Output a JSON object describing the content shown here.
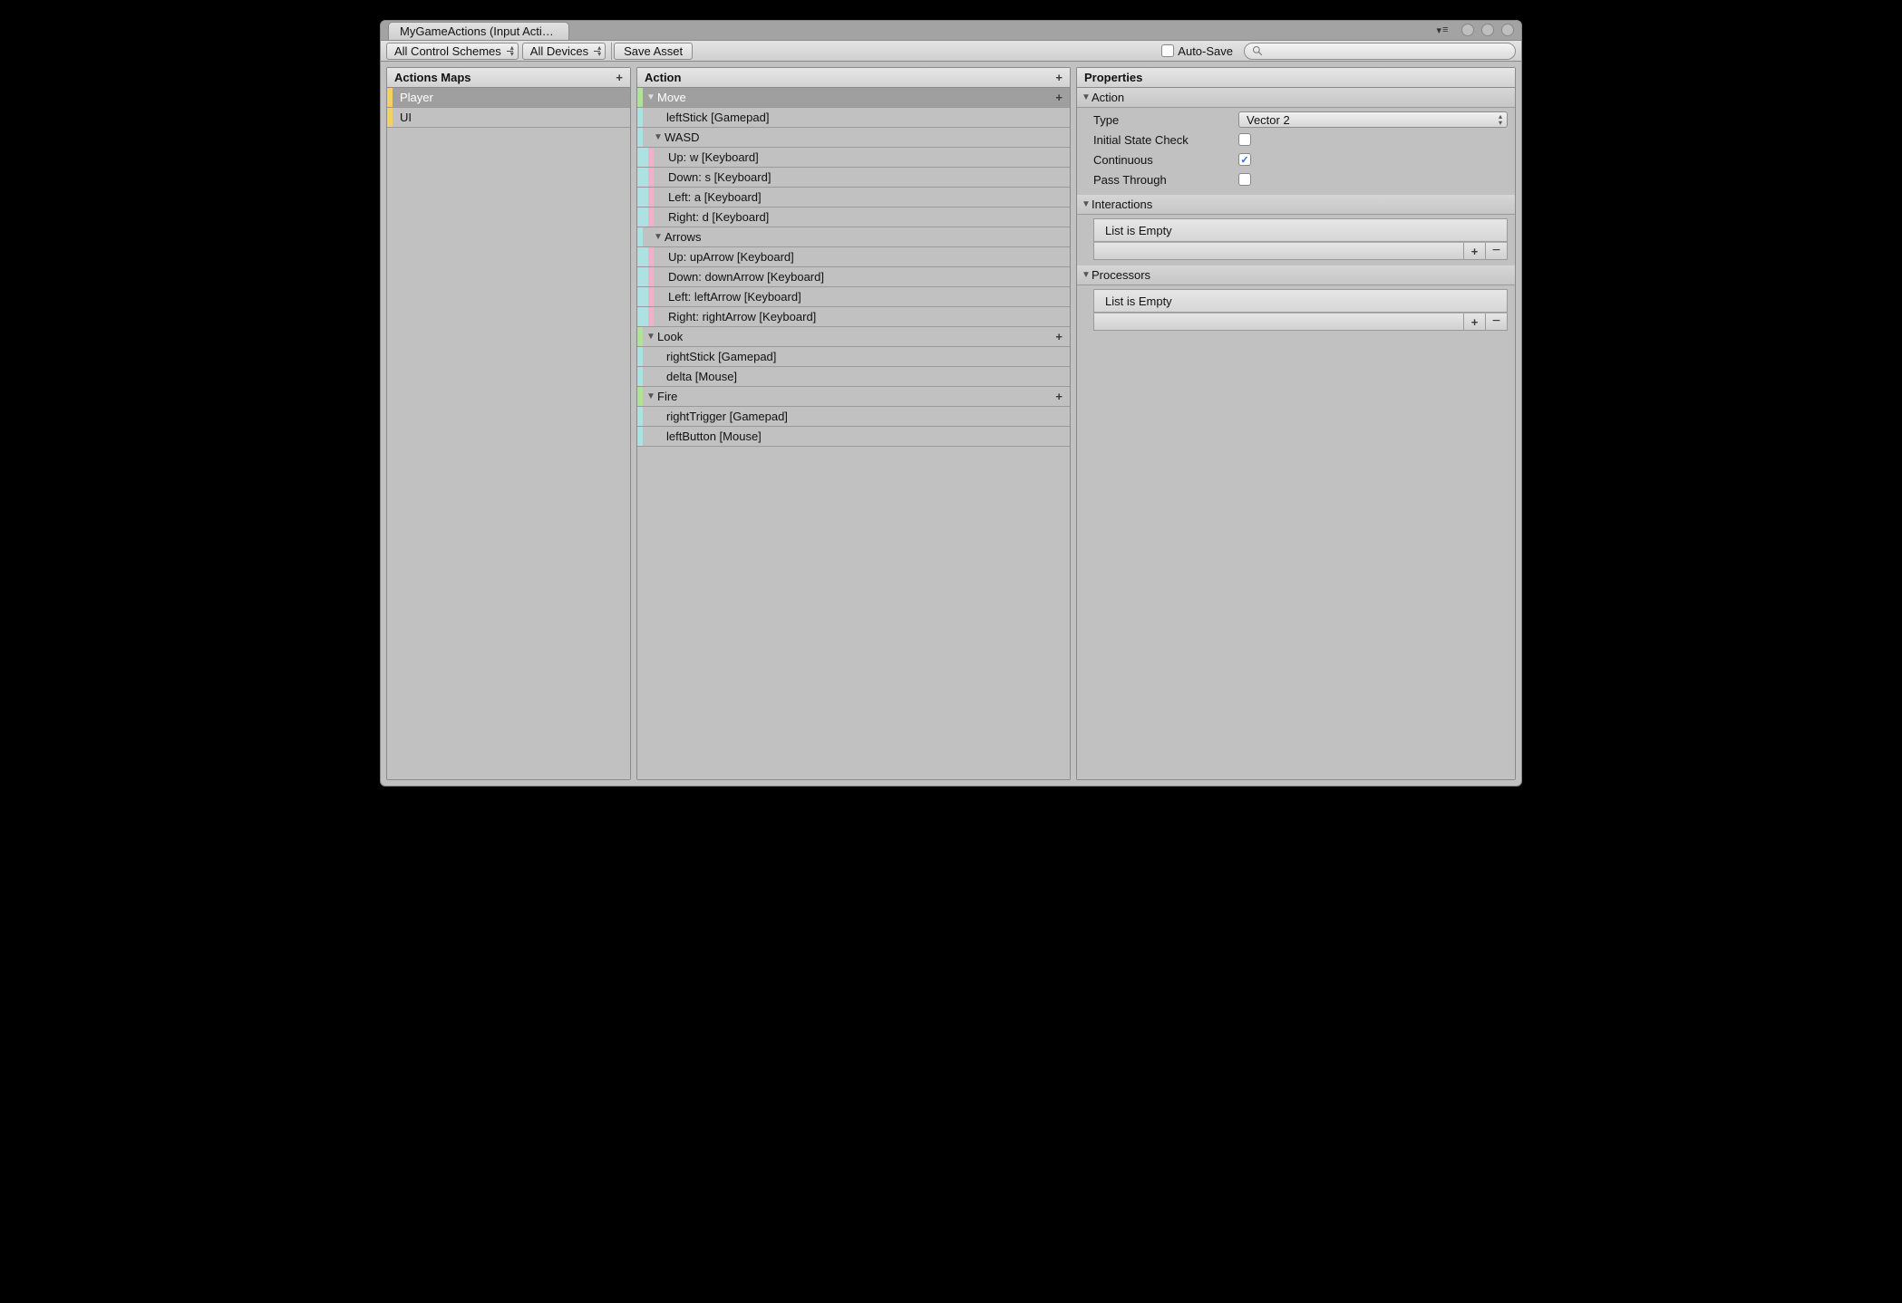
{
  "tab_title": "MyGameActions (Input Acti…",
  "toolbar": {
    "scheme_label": "All Control Schemes",
    "devices_label": "All Devices",
    "save_label": "Save Asset",
    "autosave_label": "Auto-Save",
    "autosave_checked": false
  },
  "panes": {
    "maps_title": "Actions Maps",
    "actions_title": "Action",
    "props_title": "Properties"
  },
  "maps": [
    {
      "name": "Player",
      "selected": true
    },
    {
      "name": "UI",
      "selected": false
    }
  ],
  "actionsTree": [
    {
      "kind": "action",
      "label": "Move",
      "selected": true,
      "plus": true
    },
    {
      "kind": "binding",
      "label": "leftStick [Gamepad]"
    },
    {
      "kind": "composite",
      "label": "WASD"
    },
    {
      "kind": "part",
      "label": "Up: w [Keyboard]"
    },
    {
      "kind": "part",
      "label": "Down: s [Keyboard]"
    },
    {
      "kind": "part",
      "label": "Left: a [Keyboard]"
    },
    {
      "kind": "part",
      "label": "Right: d [Keyboard]"
    },
    {
      "kind": "composite",
      "label": "Arrows"
    },
    {
      "kind": "part",
      "label": "Up: upArrow [Keyboard]"
    },
    {
      "kind": "part",
      "label": "Down: downArrow [Keyboard]"
    },
    {
      "kind": "part",
      "label": "Left: leftArrow [Keyboard]"
    },
    {
      "kind": "part",
      "label": "Right: rightArrow [Keyboard]"
    },
    {
      "kind": "action",
      "label": "Look",
      "plus": true
    },
    {
      "kind": "binding",
      "label": "rightStick [Gamepad]"
    },
    {
      "kind": "binding",
      "label": "delta [Mouse]"
    },
    {
      "kind": "action",
      "label": "Fire",
      "plus": true
    },
    {
      "kind": "binding",
      "label": "rightTrigger [Gamepad]"
    },
    {
      "kind": "binding",
      "label": "leftButton [Mouse]"
    }
  ],
  "properties": {
    "action_section": "Action",
    "type_label": "Type",
    "type_value": "Vector 2",
    "initial_label": "Initial State Check",
    "initial_value": false,
    "continuous_label": "Continuous",
    "continuous_value": true,
    "passthrough_label": "Pass Through",
    "passthrough_value": false,
    "interactions_section": "Interactions",
    "interactions_empty": "List is Empty",
    "processors_section": "Processors",
    "processors_empty": "List is Empty"
  }
}
